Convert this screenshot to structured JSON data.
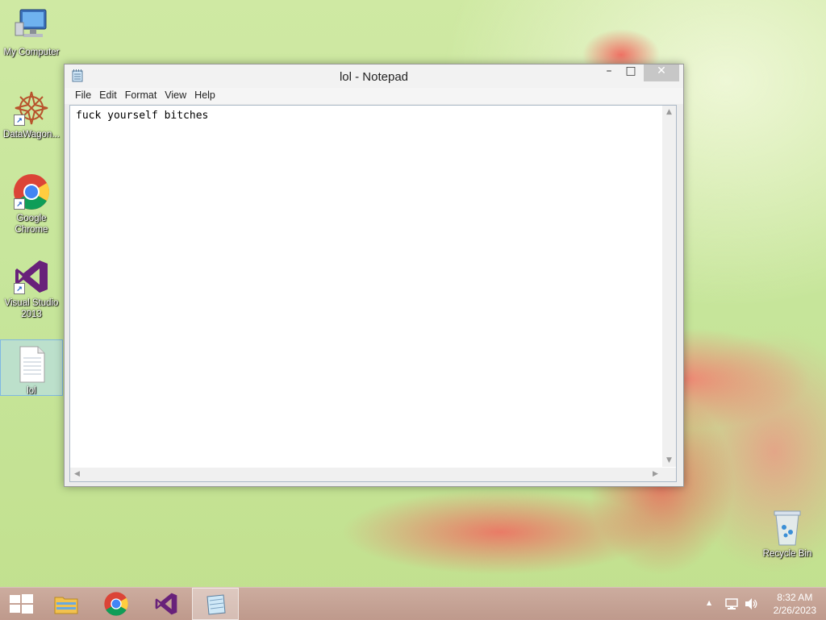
{
  "desktop": {
    "icons": [
      {
        "label": "My Computer",
        "icon": "computer-icon"
      },
      {
        "label": "DataWagon...",
        "icon": "datawagon-icon"
      },
      {
        "label": "Google Chrome",
        "icon": "chrome-icon"
      },
      {
        "label": "Visual Studio 2013",
        "icon": "visual-studio-icon"
      },
      {
        "label": "lol",
        "icon": "text-file-icon"
      }
    ],
    "recycle_bin": {
      "label": "Recycle Bin",
      "icon": "recycle-bin-icon"
    }
  },
  "notepad": {
    "title": "lol - Notepad",
    "controls": {
      "minimize": "–",
      "maximize": "□",
      "close": "✕"
    },
    "menu": [
      "File",
      "Edit",
      "Format",
      "View",
      "Help"
    ],
    "content": "fuck yourself bitches"
  },
  "taskbar": {
    "buttons": [
      {
        "name": "start",
        "icon": "windows-logo-icon"
      },
      {
        "name": "file-explorer",
        "icon": "folder-icon"
      },
      {
        "name": "chrome",
        "icon": "chrome-icon"
      },
      {
        "name": "visual-studio",
        "icon": "visual-studio-icon"
      },
      {
        "name": "notepad",
        "icon": "notepad-icon",
        "active": true
      }
    ],
    "tray": {
      "up_arrow": "▲",
      "time": "8:32 AM",
      "date": "2/26/2023"
    }
  }
}
